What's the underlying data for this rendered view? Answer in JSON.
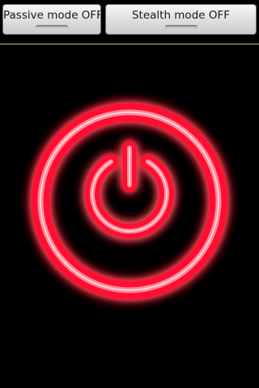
{
  "toolbar": {
    "passive_label": "Passive mode OFF",
    "stealth_label": "Stealth mode OFF"
  },
  "power_button": {
    "icon": "power-icon",
    "color": "#ff1030",
    "state": "off"
  },
  "colors": {
    "background": "#000000",
    "divider": "#b8d47a",
    "glow": "#ff1030",
    "button_bg": "#dedede"
  }
}
